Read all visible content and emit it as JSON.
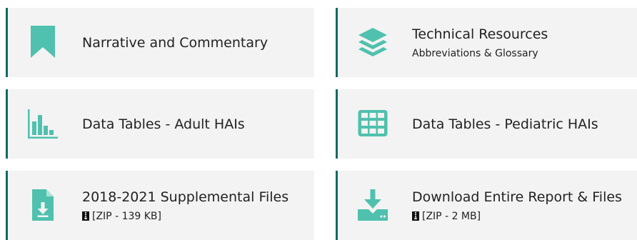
{
  "colors": {
    "accent": "#4fc1ae",
    "border": "#0f6b5f",
    "card_bg": "#f3f3f3",
    "text": "#222222"
  },
  "cards": [
    {
      "title": "Narrative and Commentary",
      "icon": "bookmark-icon"
    },
    {
      "title": "Technical Resources",
      "subtitle": "Abbreviations & Glossary",
      "icon": "layers-icon"
    },
    {
      "title": "Data Tables - Adult HAIs",
      "icon": "bar-chart-icon"
    },
    {
      "title": "Data Tables - Pediatric HAIs",
      "icon": "table-icon"
    },
    {
      "title": "2018-2021 Supplemental Files",
      "subtitle": "[ZIP - 139 KB]",
      "icon": "file-download-icon",
      "subtitle_icon": "zip-file-icon"
    },
    {
      "title": "Download Entire Report & Files",
      "subtitle": "[ZIP - 2 MB]",
      "icon": "download-tray-icon",
      "subtitle_icon": "zip-file-icon"
    }
  ]
}
